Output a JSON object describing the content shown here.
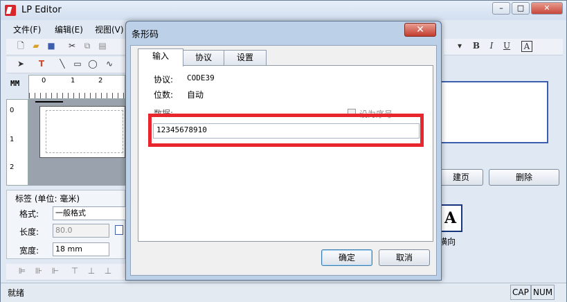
{
  "app": {
    "title": "LP Editor"
  },
  "menu": [
    "文件(F)",
    "编辑(E)",
    "视图(V)"
  ],
  "ruler": {
    "unit": "MM",
    "h_ticks": [
      "0",
      "1",
      "2"
    ],
    "v_ticks": [
      "0",
      "1",
      "2"
    ]
  },
  "label_panel": {
    "title": "标签 (单位: 毫米)",
    "format_label": "格式:",
    "format_value": "一般格式",
    "length_label": "长度:",
    "length_value": "80.0",
    "width_label": "宽度:",
    "width_value": "18 mm"
  },
  "right": {
    "new_page": "建页",
    "delete": "删除",
    "horizontal": "横向"
  },
  "format_toolbar": [
    "B",
    "I",
    "U",
    "A"
  ],
  "status": {
    "ready": "就绪",
    "cap": "CAP",
    "num": "NUM"
  },
  "dialog": {
    "title": "条形码",
    "tabs": [
      "输入",
      "协议",
      "设置"
    ],
    "protocol_label": "协议:",
    "protocol_value": "CODE39",
    "digits_label": "位数:",
    "digits_value": "自动",
    "data_label": "数据:",
    "seq_label": "设为序号",
    "data_value": "12345678910",
    "ok": "确定",
    "cancel": "取消"
  },
  "colors": {
    "highlight": "#e8262d",
    "accent": "#3b5fae"
  }
}
